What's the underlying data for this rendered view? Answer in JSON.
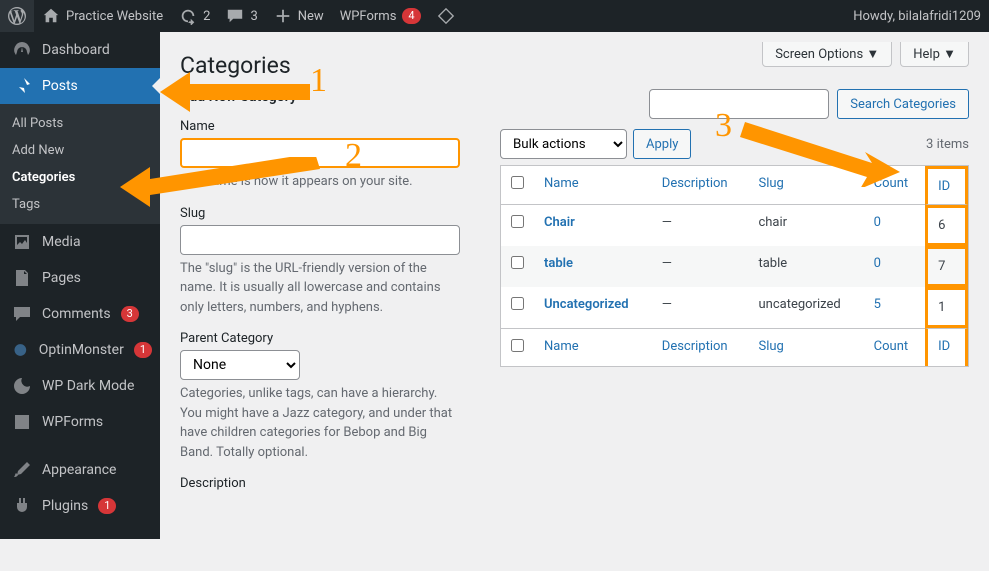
{
  "adminbar": {
    "site_name": "Practice Website",
    "updates": "2",
    "comments": "3",
    "new_label": "New",
    "wpforms_label": "WPForms",
    "wpforms_badge": "4",
    "howdy": "Howdy, bilalafridi1209"
  },
  "sidebar": {
    "dashboard": "Dashboard",
    "posts": "Posts",
    "posts_sub": {
      "all": "All Posts",
      "add": "Add New",
      "categories": "Categories",
      "tags": "Tags"
    },
    "media": "Media",
    "pages": "Pages",
    "comments": "Comments",
    "comments_badge": "3",
    "optinmonster": "OptinMonster",
    "optin_badge": "1",
    "darkmode": "WP Dark Mode",
    "wpforms": "WPForms",
    "appearance": "Appearance",
    "plugins": "Plugins",
    "plugins_badge": "1"
  },
  "top": {
    "screen_options": "Screen Options",
    "help": "Help"
  },
  "page": {
    "title": "Categories",
    "form_title": "Add New Category",
    "name_label": "Name",
    "name_help": "The name is how it appears on your site.",
    "slug_label": "Slug",
    "slug_help": "The \"slug\" is the URL-friendly version of the name. It is usually all lowercase and contains only letters, numbers, and hyphens.",
    "parent_label": "Parent Category",
    "parent_none": "None",
    "parent_help": "Categories, unlike tags, can have a hierarchy. You might have a Jazz category, and under that have children categories for Bebop and Big Band. Totally optional.",
    "desc_label": "Description"
  },
  "table": {
    "search_btn": "Search Categories",
    "bulk_label": "Bulk actions",
    "apply": "Apply",
    "item_count": "3 items",
    "cols": {
      "name": "Name",
      "desc": "Description",
      "slug": "Slug",
      "count": "Count",
      "id": "ID"
    },
    "rows": [
      {
        "name": "Chair",
        "desc": "—",
        "slug": "chair",
        "count": "0",
        "id": "6"
      },
      {
        "name": "table",
        "desc": "—",
        "slug": "table",
        "count": "0",
        "id": "7"
      },
      {
        "name": "Uncategorized",
        "desc": "—",
        "slug": "uncategorized",
        "count": "5",
        "id": "1"
      }
    ]
  },
  "anno": {
    "n1": "1",
    "n2": "2",
    "n3": "3"
  }
}
